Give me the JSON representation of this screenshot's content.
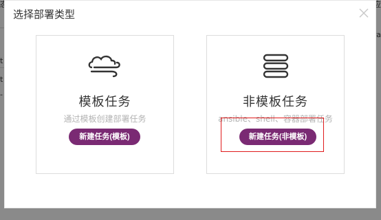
{
  "background": {
    "fragments": [
      "态",
      "应",
      "t",
      "t",
      "-",
      "ra"
    ]
  },
  "modal": {
    "title": "选择部署类型",
    "close_icon": "close-icon"
  },
  "cards": [
    {
      "icon": "wind-cloud-icon",
      "title": "模板任务",
      "description": "通过模板创建部署任务",
      "button_label": "新建任务(模板)"
    },
    {
      "icon": "server-stack-icon",
      "title": "非模板任务",
      "description": "ansible、shell、容器部署任务",
      "button_label": "新建任务(非模板)"
    }
  ],
  "colors": {
    "accent": "#7a2a73",
    "highlight": "#e0191a",
    "overlay": "#8a8a8a"
  }
}
